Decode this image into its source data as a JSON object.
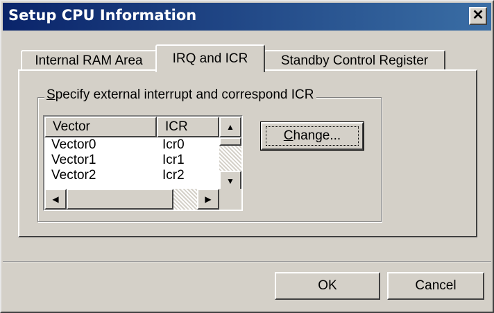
{
  "window": {
    "title": "Setup CPU Information",
    "close_glyph": "✕"
  },
  "tabs": [
    {
      "label": "Internal RAM Area",
      "active": false
    },
    {
      "label": "IRQ and ICR",
      "active": true
    },
    {
      "label": "Standby Control Register",
      "active": false
    }
  ],
  "group": {
    "label_mnemonic": "S",
    "label_rest": "pecify external interrupt and correspond ICR"
  },
  "list": {
    "columns": [
      "Vector",
      "ICR"
    ],
    "rows": [
      {
        "vector": "Vector0",
        "icr": "Icr0"
      },
      {
        "vector": "Vector1",
        "icr": "Icr1"
      },
      {
        "vector": "Vector2",
        "icr": "Icr2"
      }
    ]
  },
  "change_button": {
    "mnemonic": "C",
    "rest": "hange..."
  },
  "footer": {
    "ok_label": "OK",
    "cancel_label": "Cancel"
  },
  "icons": {
    "up": "▲",
    "down": "▼",
    "left": "◀",
    "right": "▶"
  }
}
